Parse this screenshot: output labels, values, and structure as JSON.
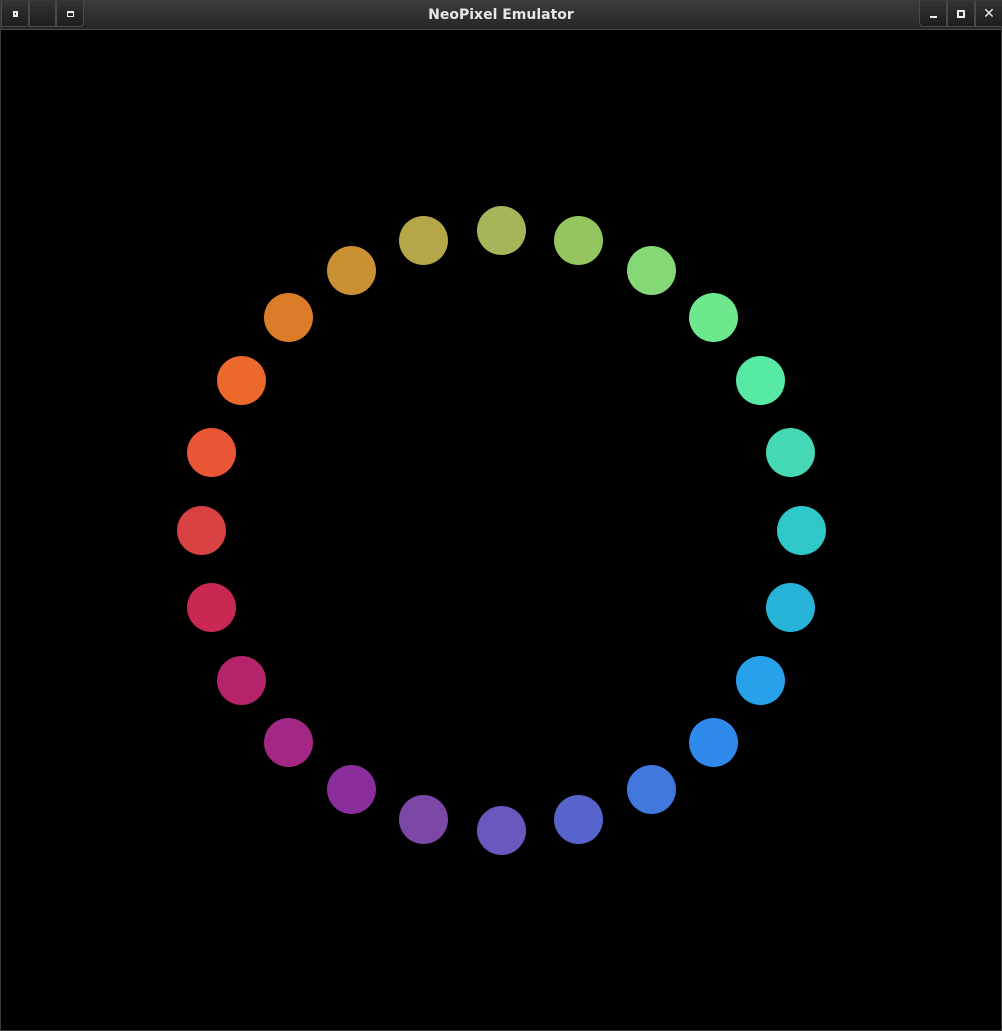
{
  "window": {
    "title": "NeoPixel Emulator",
    "buttons": {
      "menu": "window-menu",
      "blank": "",
      "shade": "shade",
      "minimize": "minimize",
      "maximize": "maximize",
      "close": "close"
    }
  },
  "ring": {
    "led_count": 24,
    "background": "#000000",
    "leds": [
      {
        "index": 0,
        "color": "#a5b55a"
      },
      {
        "index": 1,
        "color": "#94c55e"
      },
      {
        "index": 2,
        "color": "#85d876"
      },
      {
        "index": 3,
        "color": "#6de88d"
      },
      {
        "index": 4,
        "color": "#57eaa4"
      },
      {
        "index": 5,
        "color": "#44d8b5"
      },
      {
        "index": 6,
        "color": "#2fc8c8"
      },
      {
        "index": 7,
        "color": "#27b4d8"
      },
      {
        "index": 8,
        "color": "#27a2ea"
      },
      {
        "index": 9,
        "color": "#2f8aec"
      },
      {
        "index": 10,
        "color": "#4277dd"
      },
      {
        "index": 11,
        "color": "#5764cb"
      },
      {
        "index": 12,
        "color": "#6d56bd"
      },
      {
        "index": 13,
        "color": "#7b48a6"
      },
      {
        "index": 14,
        "color": "#8a2e9b"
      },
      {
        "index": 15,
        "color": "#a32784"
      },
      {
        "index": 16,
        "color": "#b52468"
      },
      {
        "index": 17,
        "color": "#c82851"
      },
      {
        "index": 18,
        "color": "#d84242"
      },
      {
        "index": 19,
        "color": "#e95636"
      },
      {
        "index": 20,
        "color": "#ed682b"
      },
      {
        "index": 21,
        "color": "#db7c28"
      },
      {
        "index": 22,
        "color": "#c99132"
      },
      {
        "index": 23,
        "color": "#b5a64a"
      }
    ]
  }
}
